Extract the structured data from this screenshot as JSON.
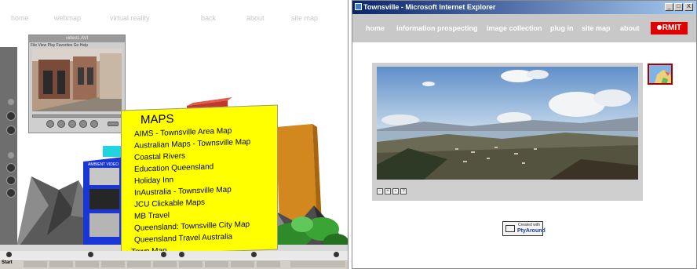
{
  "left": {
    "nav": [
      "home",
      "webmap",
      "virtual reality",
      "back",
      "about",
      "site map"
    ],
    "player": {
      "title": "video1.AVI",
      "menu": "File  View  Play  Favorites  Go  Help"
    },
    "small_panel_label": "AMBIENT VIDEO",
    "maps": {
      "title": "MAPS",
      "items": [
        "AIMS - Townsville Area Map",
        "Australian Maps - Townsville Map",
        "Coastal Rivers",
        "Education Queensland",
        "Holiday Inn",
        "InAustralia - Townsville Map",
        "JCU Clickable Maps",
        "MB Travel",
        "Queensland: Townsville City Map",
        "Queensland Travel Australia",
        "Town Map"
      ]
    },
    "taskbar": {
      "start": "Start"
    }
  },
  "right": {
    "window_title": "Townsville - Microsoft Internet Explorer",
    "window_buttons": [
      "_",
      "□",
      "X"
    ],
    "nav": [
      "home",
      "information prospecting",
      "image collection",
      "plug in",
      "site map",
      "about"
    ],
    "logo": "RMIT",
    "viewer_controls": [
      "zoom-out-icon",
      "zoom-in-icon",
      "pan-icon",
      "help-icon"
    ],
    "viewer_control_glyphs": [
      "◦",
      "+",
      "‹",
      "?"
    ],
    "badge": {
      "line1": "Created with",
      "line2": "PtyAround"
    }
  },
  "colors": {
    "maps_bg": "#ffff00",
    "rmit_red": "#e00000",
    "nav_gray": "#c8c8c8",
    "title_blue": "#0a246a"
  }
}
